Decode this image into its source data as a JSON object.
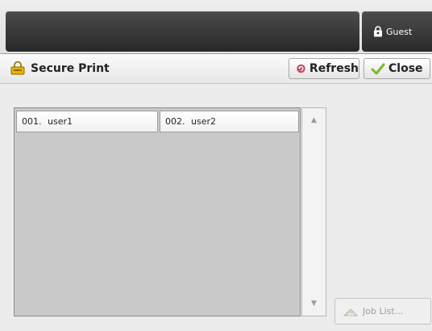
{
  "header": {
    "user_label": "Guest",
    "user_icon": "lock-icon"
  },
  "titlebar": {
    "title": "Secure Print",
    "title_icon": "secure-print-icon",
    "refresh_label": "Refresh",
    "close_label": "Close"
  },
  "user_list": {
    "items": [
      {
        "number": "001.",
        "name": "user1"
      },
      {
        "number": "002.",
        "name": "user2"
      }
    ]
  },
  "scroll": {
    "up_glyph": "▲",
    "down_glyph": "▼"
  },
  "job_list_label": "Job List...",
  "colors": {
    "header_dark": "#2a2a2a",
    "list_background": "#c9c9c9",
    "refresh_icon": "#c0506a",
    "close_check": "#7cba2c",
    "lock_icon_yellow": "#e8b400"
  }
}
